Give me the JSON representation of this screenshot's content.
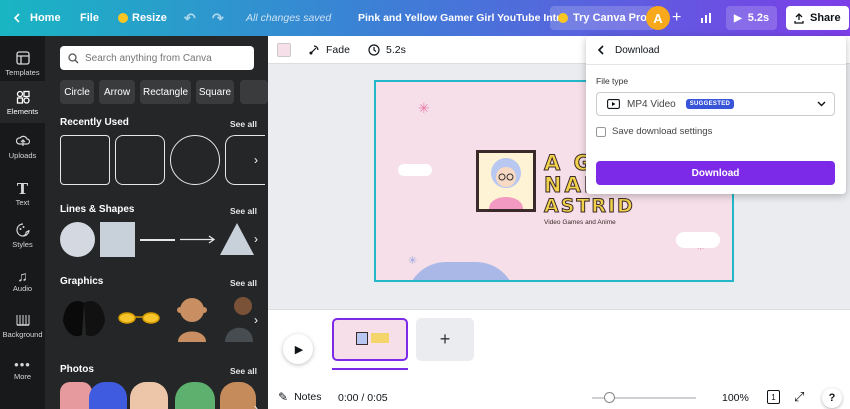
{
  "topbar": {
    "home": "Home",
    "file": "File",
    "resize": "Resize",
    "status": "All changes saved",
    "title": "Pink and Yellow Gamer Girl YouTube Intro",
    "try_pro": "Try Canva Pro",
    "avatar_letter": "A",
    "duration": "5.2s",
    "share": "Share"
  },
  "rail": [
    {
      "label": "Templates",
      "icon": "templates-icon"
    },
    {
      "label": "Elements",
      "icon": "elements-icon"
    },
    {
      "label": "Uploads",
      "icon": "uploads-icon"
    },
    {
      "label": "Text",
      "icon": "text-icon"
    },
    {
      "label": "Styles",
      "icon": "styles-icon"
    },
    {
      "label": "Audio",
      "icon": "audio-icon"
    },
    {
      "label": "Background",
      "icon": "background-icon"
    },
    {
      "label": "More",
      "icon": "more-icon"
    }
  ],
  "panel": {
    "search_placeholder": "Search anything from Canva",
    "chips": [
      "Circle",
      "Arrow",
      "Rectangle",
      "Square"
    ],
    "sections": {
      "recent": "Recently Used",
      "lines": "Lines & Shapes",
      "graphics": "Graphics",
      "photos": "Photos"
    },
    "see_all": "See all"
  },
  "toolbar": {
    "fade": "Fade",
    "duration": "5.2s"
  },
  "slide": {
    "line1": "A G",
    "line2": "NAM",
    "line3": "ASTRID",
    "subtitle": "Video Games and Anime"
  },
  "timeline": {
    "notes": "Notes",
    "time": "0:00 / 0:05",
    "zoom": "100%",
    "page": "1"
  },
  "download": {
    "header": "Download",
    "file_type_label": "File type",
    "file_type_value": "MP4 Video",
    "badge": "SUGGESTED",
    "save_settings": "Save download settings",
    "button": "Download"
  },
  "colors": {
    "accent": "#7d2ae8",
    "slide_bg": "#f6dfe9",
    "slide_title": "#f2d24b"
  }
}
